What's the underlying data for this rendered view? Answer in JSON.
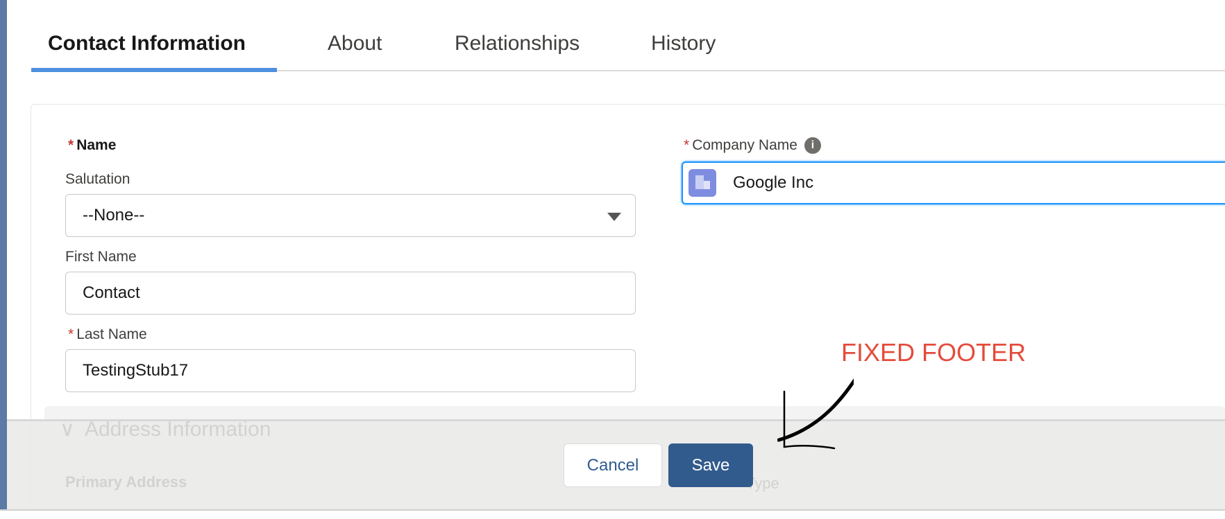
{
  "tabs": [
    {
      "label": "Contact Information",
      "active": true
    },
    {
      "label": "About"
    },
    {
      "label": "Relationships"
    },
    {
      "label": "History"
    }
  ],
  "form": {
    "name_label": "Name",
    "required_mark": "*",
    "salutation": {
      "label": "Salutation",
      "value": "--None--"
    },
    "first_name": {
      "label": "First Name",
      "value": "Contact"
    },
    "last_name": {
      "label": "Last Name",
      "value": "TestingStub17"
    },
    "company": {
      "label": "Company Name",
      "value": "Google Inc",
      "info_icon": "i"
    }
  },
  "section": {
    "title": "Address Information",
    "sub_label": "Primary Address",
    "right_label": "Type"
  },
  "footer": {
    "cancel_label": "Cancel",
    "save_label": "Save"
  },
  "annotation": {
    "text": "FIXED FOOTER",
    "color": "#e54b3c"
  },
  "colors": {
    "accent": "#4f8fe0",
    "save": "#325b8d"
  }
}
